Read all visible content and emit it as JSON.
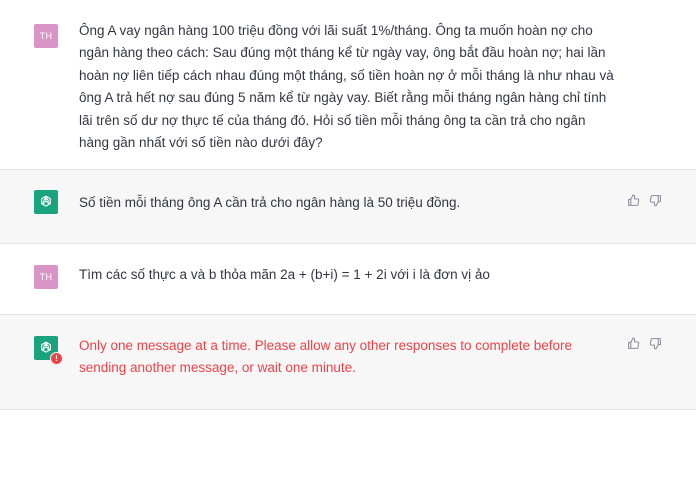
{
  "messages": [
    {
      "role": "user",
      "avatar_initials": "TH",
      "text": "Ông A vay ngân hàng 100 triệu đồng với lãi suất 1%/tháng. Ông ta muốn hoàn nợ cho ngân hàng theo cách: Sau đúng một tháng kể từ ngày vay, ông bắt đầu hoàn nợ; hai lần hoàn nợ liên tiếp cách nhau đúng một tháng, số tiền hoàn nợ ở mỗi tháng là như nhau và ông A trả hết nợ sau đúng 5 năm kể từ ngày vay. Biết rằng mỗi tháng ngân hàng chỉ tính lãi trên số dư nợ thực tế của tháng đó. Hỏi số tiền mỗi tháng ông ta cần trả cho ngân hàng gần nhất với số tiền nào dưới đây?"
    },
    {
      "role": "assistant",
      "avatar_icon": "openai-logo-icon",
      "text": "Số tiền mỗi tháng ông A cần trả cho ngân hàng là 50 triệu đồng."
    },
    {
      "role": "user",
      "avatar_initials": "TH",
      "text": "Tìm các số thực a và b thỏa mãn 2a + (b+i) = 1 + 2i với i là đơn vị ảo"
    },
    {
      "role": "assistant",
      "avatar_icon": "openai-logo-icon",
      "error_badge": "!",
      "text": "Only one message at a time. Please allow any other responses to complete before sending another message, or wait one minute."
    }
  ],
  "feedback_icons": [
    "thumbs-up-icon",
    "thumbs-down-icon"
  ],
  "colors": {
    "user_avatar": "#d995c8",
    "bot_avatar": "#19a37f",
    "bot_bg": "#f7f7f8",
    "error_text": "#ef4146",
    "text": "#343541"
  }
}
